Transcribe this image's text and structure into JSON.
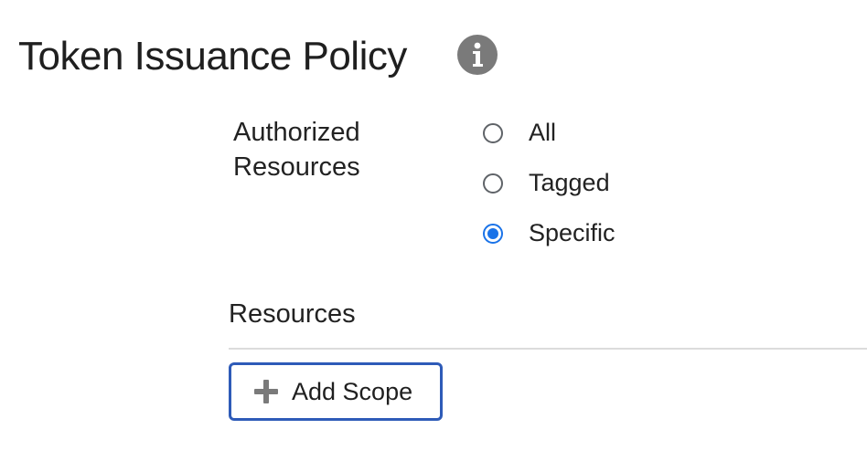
{
  "header": {
    "title": "Token Issuance Policy",
    "info_icon": "info-icon"
  },
  "authorized_resources": {
    "label": "Authorized Resources",
    "options": [
      {
        "label": "All",
        "selected": false
      },
      {
        "label": "Tagged",
        "selected": false
      },
      {
        "label": "Specific",
        "selected": true
      }
    ]
  },
  "resources": {
    "section_title": "Resources",
    "add_button_label": "Add Scope",
    "add_button_icon": "plus-icon"
  },
  "colors": {
    "accent": "#1a73e8",
    "button_border": "#2e5bb8",
    "icon_gray": "#7a7a7a",
    "divider": "#dcdcdc"
  }
}
